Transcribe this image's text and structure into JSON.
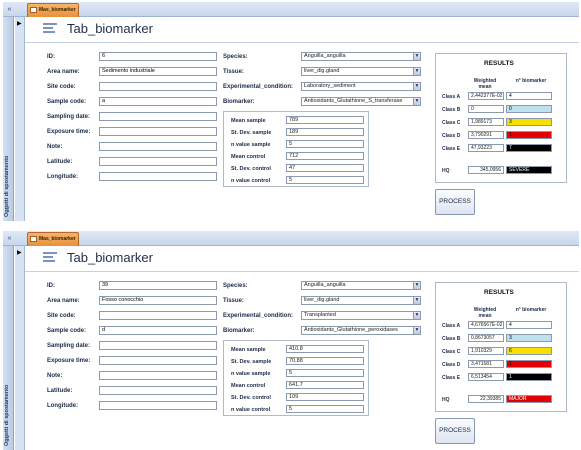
{
  "colors": {
    "class_a": "#ffffff",
    "class_b": "#bfe1ef",
    "class_c": "#f7e000",
    "class_d": "#e30000",
    "class_e": "#000000",
    "hq_severe": "#000000",
    "hq_high": "#e30000"
  },
  "records": [
    {
      "tab_label": "Mas_biomarker",
      "nav_label": "Oggetti di spostamento",
      "form_title": "Tab_biomarker",
      "fields": {
        "id": {
          "label": "ID:",
          "value": "6"
        },
        "area_name": {
          "label": "Area name:",
          "value": "Sedimento industriale"
        },
        "site_code": {
          "label": "Site code:",
          "value": ""
        },
        "sample_code": {
          "label": "Sample code:",
          "value": "a"
        },
        "sampling_date": {
          "label": "Sampling date:",
          "value": ""
        },
        "exposure_time": {
          "label": "Exposure time:",
          "value": ""
        },
        "note": {
          "label": "Note:",
          "value": ""
        },
        "latitude": {
          "label": "Latitude:",
          "value": ""
        },
        "longitude": {
          "label": "Longitude:",
          "value": ""
        }
      },
      "combos": {
        "species": {
          "label": "Species:",
          "value": "Anguilla_anguilla"
        },
        "tissue": {
          "label": "Tissue:",
          "value": "liver_dig.gland"
        },
        "experimental_condition": {
          "label": "Experimental_condition:",
          "value": "Laboratory_sediment"
        },
        "biomarker": {
          "label": "Biomarker:",
          "value": "Antioxidants_Glutathione_S_transferase"
        }
      },
      "stats": {
        "mean_sample": {
          "label": "Mean sample",
          "value": "789"
        },
        "sd_sample": {
          "label": "St. Dev. sample",
          "value": "189"
        },
        "n_sample": {
          "label": "n value sample",
          "value": "5"
        },
        "mean_control": {
          "label": "Mean control",
          "value": "712"
        },
        "sd_control": {
          "label": "St. Dev. control",
          "value": "47"
        },
        "n_control": {
          "label": "n value control",
          "value": "5"
        }
      },
      "results": {
        "title": "RESULTS",
        "col_weighted": "Weighted mean",
        "col_n": "n° biomarker",
        "classes": [
          {
            "label": "Class A",
            "weighted": "2,442377E-02",
            "count": "4",
            "color_key": "class_a"
          },
          {
            "label": "Class B",
            "weighted": "0",
            "count": "0",
            "color_key": "class_b"
          },
          {
            "label": "Class C",
            "weighted": "1,989173",
            "count": "3",
            "color_key": "class_c"
          },
          {
            "label": "Class D",
            "weighted": "3,790291",
            "count": "1",
            "color_key": "class_d"
          },
          {
            "label": "Class E",
            "weighted": "47,93223",
            "count": "7",
            "color_key": "class_e"
          }
        ],
        "hq_label": "HQ",
        "hq_value": "345,0956",
        "hq_level": "SEVERE",
        "hq_color_key": "hq_severe"
      },
      "process_label": "PROCESS"
    },
    {
      "tab_label": "Mas_biomarker",
      "nav_label": "Oggetti di spostamento",
      "form_title": "Tab_biomarker",
      "fields": {
        "id": {
          "label": "ID:",
          "value": "39"
        },
        "area_name": {
          "label": "Area name:",
          "value": "Fosso conocchio"
        },
        "site_code": {
          "label": "Site code:",
          "value": ""
        },
        "sample_code": {
          "label": "Sample code:",
          "value": "d"
        },
        "sampling_date": {
          "label": "Sampling date:",
          "value": ""
        },
        "exposure_time": {
          "label": "Exposure time:",
          "value": ""
        },
        "note": {
          "label": "Note:",
          "value": ""
        },
        "latitude": {
          "label": "Latitude:",
          "value": ""
        },
        "longitude": {
          "label": "Longitude:",
          "value": ""
        }
      },
      "combos": {
        "species": {
          "label": "Species:",
          "value": "Anguilla_anguilla"
        },
        "tissue": {
          "label": "Tissue:",
          "value": "liver_dig.gland"
        },
        "experimental_condition": {
          "label": "Experimental_condition:",
          "value": "Transplanted"
        },
        "biomarker": {
          "label": "Biomarker:",
          "value": "Antioxidants_Glutathione_peroxidases"
        }
      },
      "stats": {
        "mean_sample": {
          "label": "Mean sample",
          "value": "410,8"
        },
        "sd_sample": {
          "label": "St. Dev. sample",
          "value": "70,88"
        },
        "n_sample": {
          "label": "n value sample",
          "value": "5"
        },
        "mean_control": {
          "label": "Mean control",
          "value": "641,7"
        },
        "sd_control": {
          "label": "St. Dev. control",
          "value": "109"
        },
        "n_control": {
          "label": "n value control",
          "value": "5"
        }
      },
      "results": {
        "title": "RESULTS",
        "col_weighted": "Weighted mean",
        "col_n": "n° biomarker",
        "classes": [
          {
            "label": "Class A",
            "weighted": "4,676567E-02",
            "count": "4",
            "color_key": "class_a"
          },
          {
            "label": "Class B",
            "weighted": "0,8673057",
            "count": "3",
            "color_key": "class_b"
          },
          {
            "label": "Class C",
            "weighted": "1,910329",
            "count": "6",
            "color_key": "class_c"
          },
          {
            "label": "Class D",
            "weighted": "3,471581",
            "count": "1",
            "color_key": "class_d"
          },
          {
            "label": "Class E",
            "weighted": "6,513454",
            "count": "1",
            "color_key": "class_e"
          }
        ],
        "hq_label": "HQ",
        "hq_value": "22,39385",
        "hq_level": "MAJOR",
        "hq_color_key": "hq_high"
      },
      "process_label": "PROCESS"
    }
  ]
}
